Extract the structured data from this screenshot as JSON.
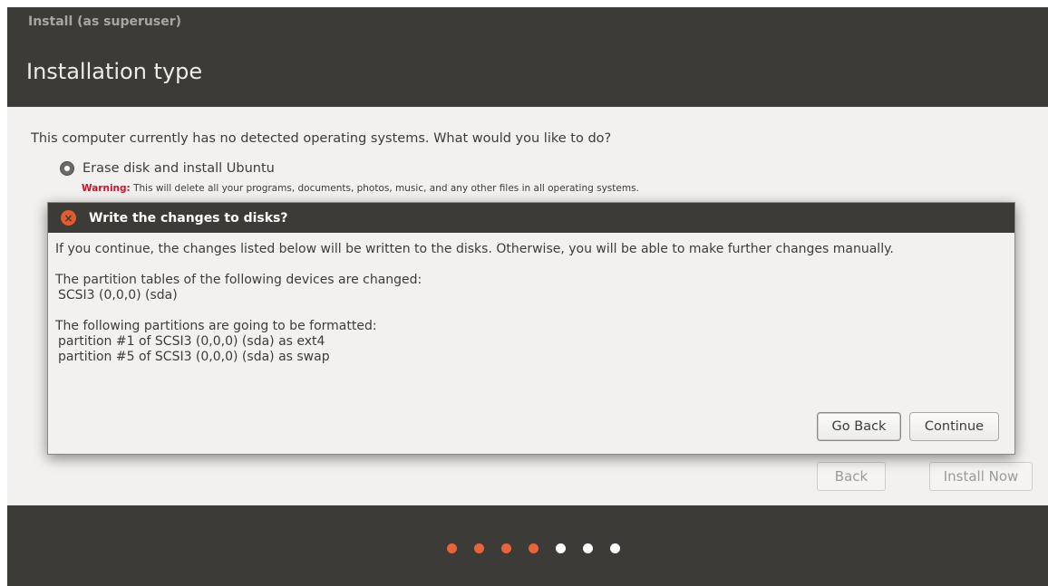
{
  "window": {
    "title": "Install (as superuser)",
    "page_title": "Installation type"
  },
  "main": {
    "question": "This computer currently has no detected operating systems. What would you like to do?",
    "option_label": "Erase disk and install Ubuntu",
    "option_selected": true,
    "warning_label": "Warning:",
    "warning_text": " This will delete all your programs, documents, photos, music, and any other files in all operating systems.",
    "back_label": "Back",
    "install_label": "Install Now"
  },
  "dialog": {
    "title": "Write the changes to disks?",
    "line1": "If you continue, the changes listed below will be written to the disks. Otherwise, you will be able to make further changes manually.",
    "line2": "The partition tables of the following devices are changed:",
    "line3": "SCSI3 (0,0,0) (sda)",
    "line4": "The following partitions are going to be formatted:",
    "line5": "partition #1 of SCSI3 (0,0,0) (sda) as ext4",
    "line6": "partition #5 of SCSI3 (0,0,0) (sda) as swap",
    "go_back_label": "Go Back",
    "continue_label": "Continue"
  },
  "progress": {
    "steps_total": 7,
    "steps_done": 4,
    "active_color": "#e9643a",
    "inactive_color": "#ffffff"
  },
  "colors": {
    "header_bg": "#3c3b37",
    "body_bg": "#f2f1f0",
    "close_icon": "#e35b2e",
    "warning": "#c7162b"
  },
  "icons": {
    "close": "close-icon",
    "radio": "radio-selected-icon"
  }
}
